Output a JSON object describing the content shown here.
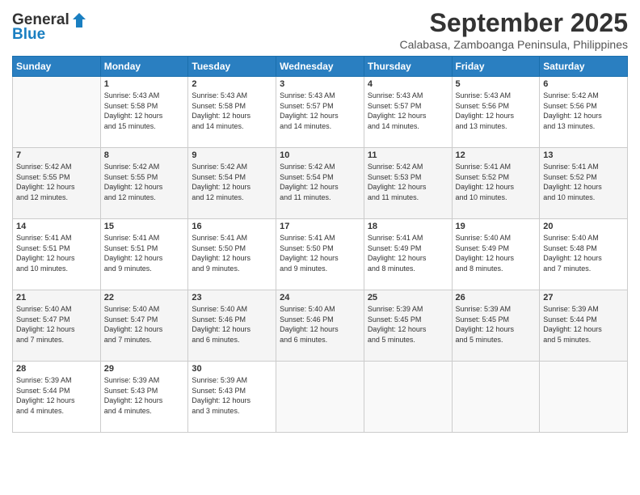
{
  "logo": {
    "line1": "General",
    "line2": "Blue"
  },
  "title": "September 2025",
  "subtitle": "Calabasa, Zamboanga Peninsula, Philippines",
  "headers": [
    "Sunday",
    "Monday",
    "Tuesday",
    "Wednesday",
    "Thursday",
    "Friday",
    "Saturday"
  ],
  "weeks": [
    [
      {
        "day": "",
        "info": ""
      },
      {
        "day": "1",
        "info": "Sunrise: 5:43 AM\nSunset: 5:58 PM\nDaylight: 12 hours\nand 15 minutes."
      },
      {
        "day": "2",
        "info": "Sunrise: 5:43 AM\nSunset: 5:58 PM\nDaylight: 12 hours\nand 14 minutes."
      },
      {
        "day": "3",
        "info": "Sunrise: 5:43 AM\nSunset: 5:57 PM\nDaylight: 12 hours\nand 14 minutes."
      },
      {
        "day": "4",
        "info": "Sunrise: 5:43 AM\nSunset: 5:57 PM\nDaylight: 12 hours\nand 14 minutes."
      },
      {
        "day": "5",
        "info": "Sunrise: 5:43 AM\nSunset: 5:56 PM\nDaylight: 12 hours\nand 13 minutes."
      },
      {
        "day": "6",
        "info": "Sunrise: 5:42 AM\nSunset: 5:56 PM\nDaylight: 12 hours\nand 13 minutes."
      }
    ],
    [
      {
        "day": "7",
        "info": "Sunrise: 5:42 AM\nSunset: 5:55 PM\nDaylight: 12 hours\nand 12 minutes."
      },
      {
        "day": "8",
        "info": "Sunrise: 5:42 AM\nSunset: 5:55 PM\nDaylight: 12 hours\nand 12 minutes."
      },
      {
        "day": "9",
        "info": "Sunrise: 5:42 AM\nSunset: 5:54 PM\nDaylight: 12 hours\nand 12 minutes."
      },
      {
        "day": "10",
        "info": "Sunrise: 5:42 AM\nSunset: 5:54 PM\nDaylight: 12 hours\nand 11 minutes."
      },
      {
        "day": "11",
        "info": "Sunrise: 5:42 AM\nSunset: 5:53 PM\nDaylight: 12 hours\nand 11 minutes."
      },
      {
        "day": "12",
        "info": "Sunrise: 5:41 AM\nSunset: 5:52 PM\nDaylight: 12 hours\nand 10 minutes."
      },
      {
        "day": "13",
        "info": "Sunrise: 5:41 AM\nSunset: 5:52 PM\nDaylight: 12 hours\nand 10 minutes."
      }
    ],
    [
      {
        "day": "14",
        "info": "Sunrise: 5:41 AM\nSunset: 5:51 PM\nDaylight: 12 hours\nand 10 minutes."
      },
      {
        "day": "15",
        "info": "Sunrise: 5:41 AM\nSunset: 5:51 PM\nDaylight: 12 hours\nand 9 minutes."
      },
      {
        "day": "16",
        "info": "Sunrise: 5:41 AM\nSunset: 5:50 PM\nDaylight: 12 hours\nand 9 minutes."
      },
      {
        "day": "17",
        "info": "Sunrise: 5:41 AM\nSunset: 5:50 PM\nDaylight: 12 hours\nand 9 minutes."
      },
      {
        "day": "18",
        "info": "Sunrise: 5:41 AM\nSunset: 5:49 PM\nDaylight: 12 hours\nand 8 minutes."
      },
      {
        "day": "19",
        "info": "Sunrise: 5:40 AM\nSunset: 5:49 PM\nDaylight: 12 hours\nand 8 minutes."
      },
      {
        "day": "20",
        "info": "Sunrise: 5:40 AM\nSunset: 5:48 PM\nDaylight: 12 hours\nand 7 minutes."
      }
    ],
    [
      {
        "day": "21",
        "info": "Sunrise: 5:40 AM\nSunset: 5:47 PM\nDaylight: 12 hours\nand 7 minutes."
      },
      {
        "day": "22",
        "info": "Sunrise: 5:40 AM\nSunset: 5:47 PM\nDaylight: 12 hours\nand 7 minutes."
      },
      {
        "day": "23",
        "info": "Sunrise: 5:40 AM\nSunset: 5:46 PM\nDaylight: 12 hours\nand 6 minutes."
      },
      {
        "day": "24",
        "info": "Sunrise: 5:40 AM\nSunset: 5:46 PM\nDaylight: 12 hours\nand 6 minutes."
      },
      {
        "day": "25",
        "info": "Sunrise: 5:39 AM\nSunset: 5:45 PM\nDaylight: 12 hours\nand 5 minutes."
      },
      {
        "day": "26",
        "info": "Sunrise: 5:39 AM\nSunset: 5:45 PM\nDaylight: 12 hours\nand 5 minutes."
      },
      {
        "day": "27",
        "info": "Sunrise: 5:39 AM\nSunset: 5:44 PM\nDaylight: 12 hours\nand 5 minutes."
      }
    ],
    [
      {
        "day": "28",
        "info": "Sunrise: 5:39 AM\nSunset: 5:44 PM\nDaylight: 12 hours\nand 4 minutes."
      },
      {
        "day": "29",
        "info": "Sunrise: 5:39 AM\nSunset: 5:43 PM\nDaylight: 12 hours\nand 4 minutes."
      },
      {
        "day": "30",
        "info": "Sunrise: 5:39 AM\nSunset: 5:43 PM\nDaylight: 12 hours\nand 3 minutes."
      },
      {
        "day": "",
        "info": ""
      },
      {
        "day": "",
        "info": ""
      },
      {
        "day": "",
        "info": ""
      },
      {
        "day": "",
        "info": ""
      }
    ]
  ]
}
